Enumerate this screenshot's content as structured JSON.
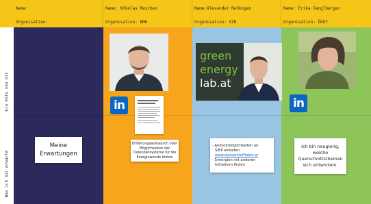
{
  "header": {
    "row1": [
      "Name:",
      "Name: Nikolas Reschen",
      "Name:Alexander Rehbogen",
      "Name: Erika Ganglberger"
    ],
    "row2": [
      "Organisation:",
      "Organisation: BMK",
      "Organisation: SIR",
      "Organisation: ÖGUT"
    ]
  },
  "rows": {
    "photo_label": "Ein Foto von mir",
    "expect_label": "Was ich mir erwarte"
  },
  "photos": {
    "alexander_banner": {
      "line1": "green",
      "line2": "energy",
      "line3": "lab.at"
    }
  },
  "icons": {
    "linkedin": "in"
  },
  "notes": {
    "n1": {
      "line1": "Meine",
      "line2": "Erwartungen"
    },
    "n2": {
      "line1": "Erfahrungsaustausch über",
      "line2": "Möglichkeiten der",
      "line3": "Datenökosysteme für die",
      "line4": "Energiewende bieten"
    },
    "n3": {
      "line1": "- Andockmöglichkeiten an",
      "line2": "S/EP anbieten",
      "line3": "www.wasserstofflabor.at",
      "line4": "- Synergien mit anderen",
      "line5": "Initiativen finden"
    },
    "n4": {
      "line1": "Ich bin neugierig,",
      "line2": "welche",
      "line3": "Querschnittsthemen",
      "line4": "sich entwickeln."
    }
  },
  "colors": {
    "header": "#f5c518",
    "col_a": "#2b2a5a",
    "col_b": "#f6a51c",
    "col_c": "#99c5e3",
    "col_d": "#8ec55a",
    "linkedin": "#0a66c2"
  }
}
